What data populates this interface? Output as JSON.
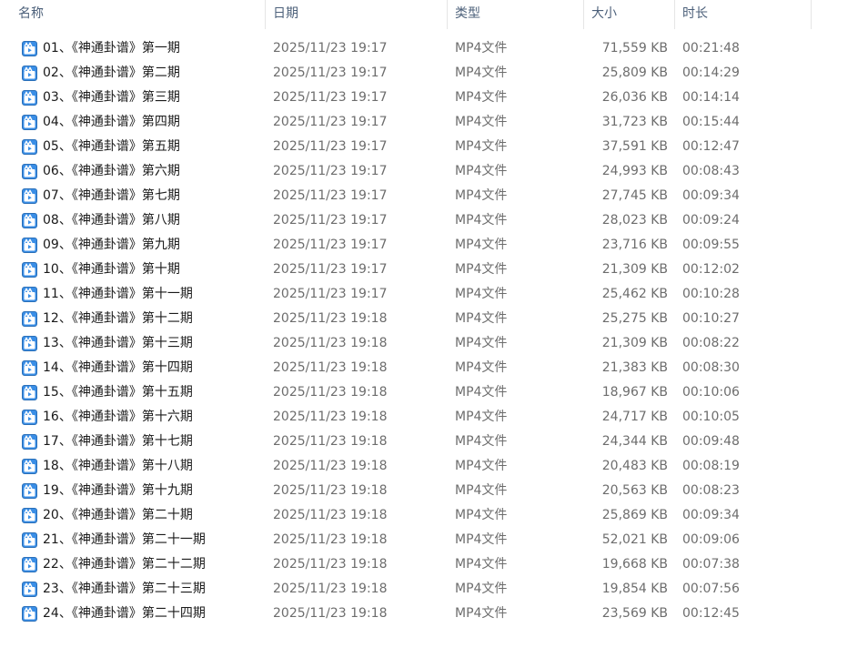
{
  "columns": {
    "name": "名称",
    "date": "日期",
    "type": "类型",
    "size": "大小",
    "duration": "时长"
  },
  "sort_indicator": "^",
  "icon": "video-file-icon",
  "accent": "#3a8ee6",
  "files": [
    {
      "name": "01、《神通卦谱》第一期",
      "date": "2025/11/23 19:17",
      "type": "MP4文件",
      "size": "71,559 KB",
      "duration": "00:21:48"
    },
    {
      "name": "02、《神通卦谱》第二期",
      "date": "2025/11/23 19:17",
      "type": "MP4文件",
      "size": "25,809 KB",
      "duration": "00:14:29"
    },
    {
      "name": "03、《神通卦谱》第三期",
      "date": "2025/11/23 19:17",
      "type": "MP4文件",
      "size": "26,036 KB",
      "duration": "00:14:14"
    },
    {
      "name": "04、《神通卦谱》第四期",
      "date": "2025/11/23 19:17",
      "type": "MP4文件",
      "size": "31,723 KB",
      "duration": "00:15:44"
    },
    {
      "name": "05、《神通卦谱》第五期",
      "date": "2025/11/23 19:17",
      "type": "MP4文件",
      "size": "37,591 KB",
      "duration": "00:12:47"
    },
    {
      "name": "06、《神通卦谱》第六期",
      "date": "2025/11/23 19:17",
      "type": "MP4文件",
      "size": "24,993 KB",
      "duration": "00:08:43"
    },
    {
      "name": "07、《神通卦谱》第七期",
      "date": "2025/11/23 19:17",
      "type": "MP4文件",
      "size": "27,745 KB",
      "duration": "00:09:34"
    },
    {
      "name": "08、《神通卦谱》第八期",
      "date": "2025/11/23 19:17",
      "type": "MP4文件",
      "size": "28,023 KB",
      "duration": "00:09:24"
    },
    {
      "name": "09、《神通卦谱》第九期",
      "date": "2025/11/23 19:17",
      "type": "MP4文件",
      "size": "23,716 KB",
      "duration": "00:09:55"
    },
    {
      "name": "10、《神通卦谱》第十期",
      "date": "2025/11/23 19:17",
      "type": "MP4文件",
      "size": "21,309 KB",
      "duration": "00:12:02"
    },
    {
      "name": "11、《神通卦谱》第十一期",
      "date": "2025/11/23 19:17",
      "type": "MP4文件",
      "size": "25,462 KB",
      "duration": "00:10:28"
    },
    {
      "name": "12、《神通卦谱》第十二期",
      "date": "2025/11/23 19:18",
      "type": "MP4文件",
      "size": "25,275 KB",
      "duration": "00:10:27"
    },
    {
      "name": "13、《神通卦谱》第十三期",
      "date": "2025/11/23 19:18",
      "type": "MP4文件",
      "size": "21,309 KB",
      "duration": "00:08:22"
    },
    {
      "name": "14、《神通卦谱》第十四期",
      "date": "2025/11/23 19:18",
      "type": "MP4文件",
      "size": "21,383 KB",
      "duration": "00:08:30"
    },
    {
      "name": "15、《神通卦谱》第十五期",
      "date": "2025/11/23 19:18",
      "type": "MP4文件",
      "size": "18,967 KB",
      "duration": "00:10:06"
    },
    {
      "name": "16、《神通卦谱》第十六期",
      "date": "2025/11/23 19:18",
      "type": "MP4文件",
      "size": "24,717 KB",
      "duration": "00:10:05"
    },
    {
      "name": "17、《神通卦谱》第十七期",
      "date": "2025/11/23 19:18",
      "type": "MP4文件",
      "size": "24,344 KB",
      "duration": "00:09:48"
    },
    {
      "name": "18、《神通卦谱》第十八期",
      "date": "2025/11/23 19:18",
      "type": "MP4文件",
      "size": "20,483 KB",
      "duration": "00:08:19"
    },
    {
      "name": "19、《神通卦谱》第十九期",
      "date": "2025/11/23 19:18",
      "type": "MP4文件",
      "size": "20,563 KB",
      "duration": "00:08:23"
    },
    {
      "name": "20、《神通卦谱》第二十期",
      "date": "2025/11/23 19:18",
      "type": "MP4文件",
      "size": "25,869 KB",
      "duration": "00:09:34"
    },
    {
      "name": "21、《神通卦谱》第二十一期",
      "date": "2025/11/23 19:18",
      "type": "MP4文件",
      "size": "52,021 KB",
      "duration": "00:09:06"
    },
    {
      "name": "22、《神通卦谱》第二十二期",
      "date": "2025/11/23 19:18",
      "type": "MP4文件",
      "size": "19,668 KB",
      "duration": "00:07:38"
    },
    {
      "name": "23、《神通卦谱》第二十三期",
      "date": "2025/11/23 19:18",
      "type": "MP4文件",
      "size": "19,854 KB",
      "duration": "00:07:56"
    },
    {
      "name": "24、《神通卦谱》第二十四期",
      "date": "2025/11/23 19:18",
      "type": "MP4文件",
      "size": "23,569 KB",
      "duration": "00:12:45"
    }
  ]
}
